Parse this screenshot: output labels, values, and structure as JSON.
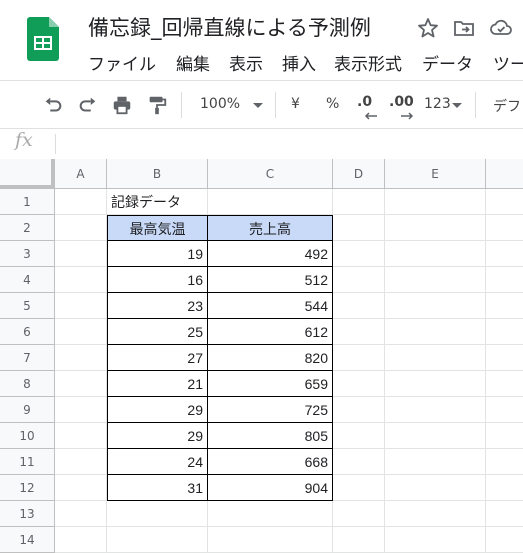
{
  "doc": {
    "title": "備忘録_回帰直線による予測例"
  },
  "menu": [
    "ファイル",
    "編集",
    "表示",
    "挿入",
    "表示形式",
    "データ",
    "ツー"
  ],
  "toolbar": {
    "zoom": "100%",
    "currency": "¥",
    "percent": "%",
    "dec_decrease": ".0",
    "dec_increase": ".00",
    "format_more": "123",
    "font": "デフ"
  },
  "formula": {
    "fx": "fx",
    "value": ""
  },
  "columns": [
    "A",
    "B",
    "C",
    "D",
    "E"
  ],
  "rows": [
    "1",
    "2",
    "3",
    "4",
    "5",
    "6",
    "7",
    "8",
    "9",
    "10",
    "11",
    "12",
    "13",
    "14"
  ],
  "sheet": {
    "title_cell": "記録データ",
    "headers": [
      "最高気温",
      "売上高"
    ],
    "data": [
      [
        19,
        492
      ],
      [
        16,
        512
      ],
      [
        23,
        544
      ],
      [
        25,
        612
      ],
      [
        27,
        820
      ],
      [
        21,
        659
      ],
      [
        29,
        725
      ],
      [
        29,
        805
      ],
      [
        24,
        668
      ],
      [
        31,
        904
      ]
    ]
  },
  "colors": {
    "logo_green": "#0f9d58",
    "header_fill": "#c9daf8"
  }
}
